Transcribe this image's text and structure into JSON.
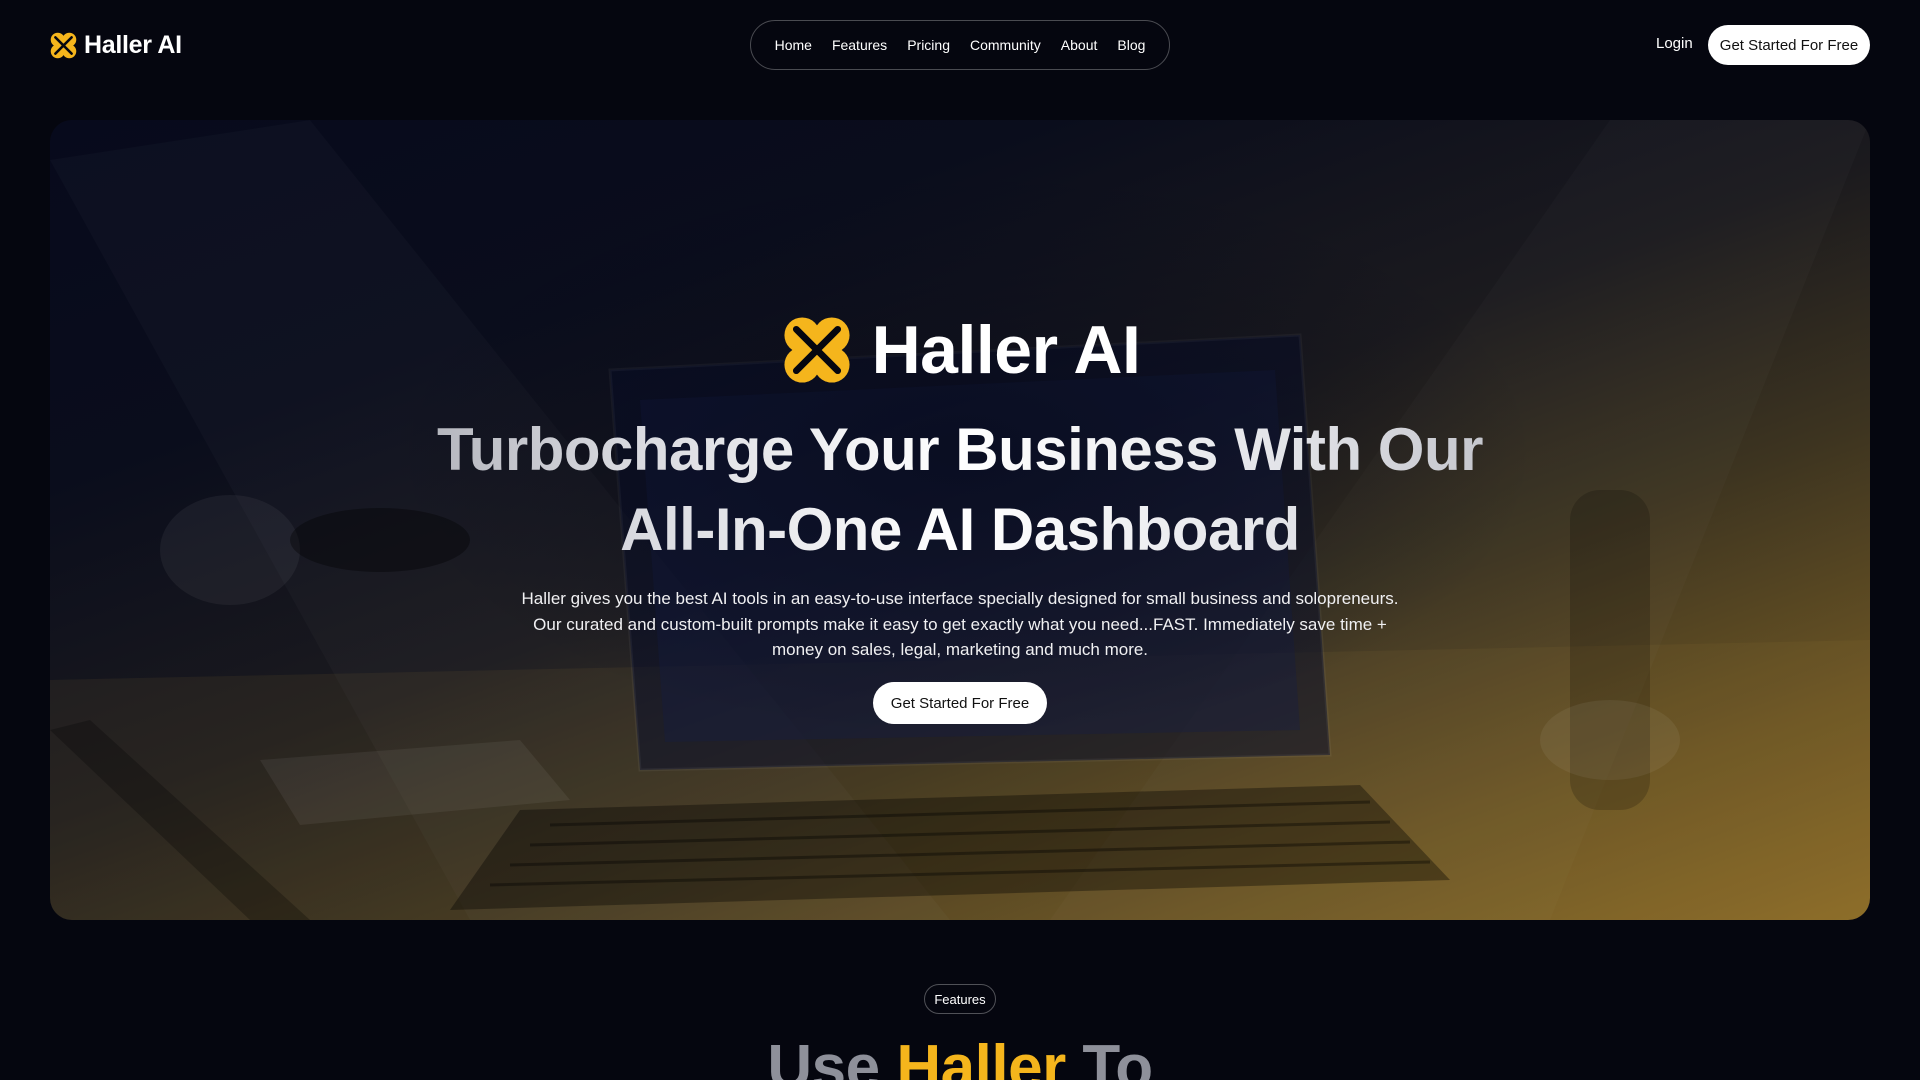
{
  "brand": {
    "name": "Haller AI",
    "accent_color": "#F5B51C",
    "icon": "clover-logo-icon"
  },
  "nav": {
    "links": [
      {
        "label": "Home"
      },
      {
        "label": "Features"
      },
      {
        "label": "Pricing"
      },
      {
        "label": "Community"
      },
      {
        "label": "About"
      },
      {
        "label": "Blog"
      }
    ],
    "login_label": "Login",
    "cta_label": "Get Started For Free"
  },
  "hero": {
    "brand_name": "Haller AI",
    "headline_line1": "Turbocharge Your Business With Our",
    "headline_line2": "All-In-One AI Dashboard",
    "description": "Haller gives you the best AI tools in an easy-to-use interface specially designed for small business and solopreneurs. Our curated and custom-built prompts make it easy to get exactly what you need...FAST. Immediately save time + money on sales, legal, marketing and much more.",
    "cta_label": "Get Started For Free"
  },
  "features": {
    "badge": "Features",
    "heading_part1": "Use ",
    "heading_accent": "Haller",
    "heading_part2": " To"
  }
}
